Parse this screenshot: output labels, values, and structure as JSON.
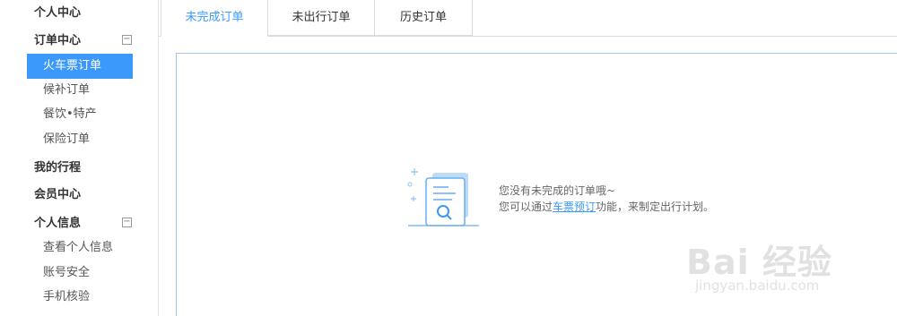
{
  "sidebar": {
    "personal_center": "个人中心",
    "order_center": "订单中心",
    "order_center_toggle": "−",
    "order_items": [
      "火车票订单",
      "候补订单",
      "餐饮•特产",
      "保险订单"
    ],
    "my_trips": "我的行程",
    "member_center": "会员中心",
    "personal_info": "个人信息",
    "personal_info_toggle": "−",
    "info_items": [
      "查看个人信息",
      "账号安全",
      "手机核验"
    ]
  },
  "tabs": [
    "未完成订单",
    "未出行订单",
    "历史订单"
  ],
  "empty_state": {
    "line1": "您没有未完成的订单哦~",
    "line2_prefix": "您可以通过",
    "line2_link": "车票预订",
    "line2_suffix": "功能，来制定出行计划。",
    "icon": "document-search-icon"
  },
  "watermark": {
    "logo": "Bai 经验",
    "url": "jingyan.baidu.com"
  },
  "colors": {
    "accent": "#3b99fc",
    "panel_border": "#9fc8ee"
  }
}
